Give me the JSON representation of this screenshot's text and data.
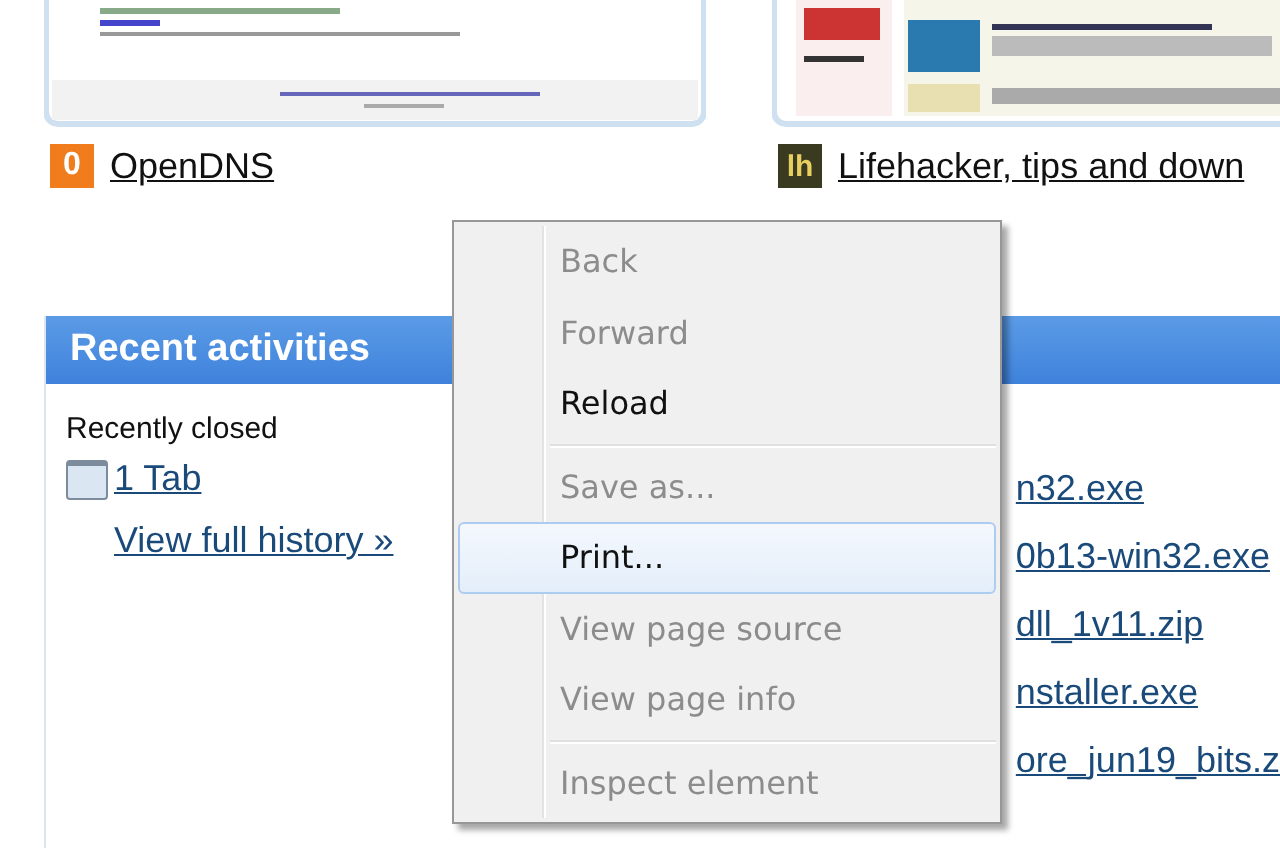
{
  "sites": [
    {
      "badge": "0",
      "label": "OpenDNS"
    },
    {
      "badge": "lh",
      "label": "Lifehacker, tips and down"
    }
  ],
  "recent": {
    "title": "Recent activities",
    "closed_heading": "Recently closed",
    "closed": [
      {
        "label": "1 Tab"
      }
    ],
    "history_link": "View full history",
    "history_arrow": "»",
    "downloads": [
      "n32.exe",
      "0b13-win32.exe",
      "dll_1v11.zip",
      "nstaller.exe",
      "ore_jun19_bits.z"
    ]
  },
  "context_menu": {
    "groups": [
      [
        {
          "label": "Back",
          "disabled": true,
          "selected": false
        },
        {
          "label": "Forward",
          "disabled": true,
          "selected": false
        },
        {
          "label": "Reload",
          "disabled": false,
          "selected": false
        }
      ],
      [
        {
          "label": "Save as...",
          "disabled": true,
          "selected": false
        },
        {
          "label": "Print...",
          "disabled": false,
          "selected": true
        },
        {
          "label": "View page source",
          "disabled": true,
          "selected": false
        },
        {
          "label": "View page info",
          "disabled": true,
          "selected": false
        }
      ],
      [
        {
          "label": "Inspect element",
          "disabled": true,
          "selected": false
        }
      ]
    ]
  }
}
